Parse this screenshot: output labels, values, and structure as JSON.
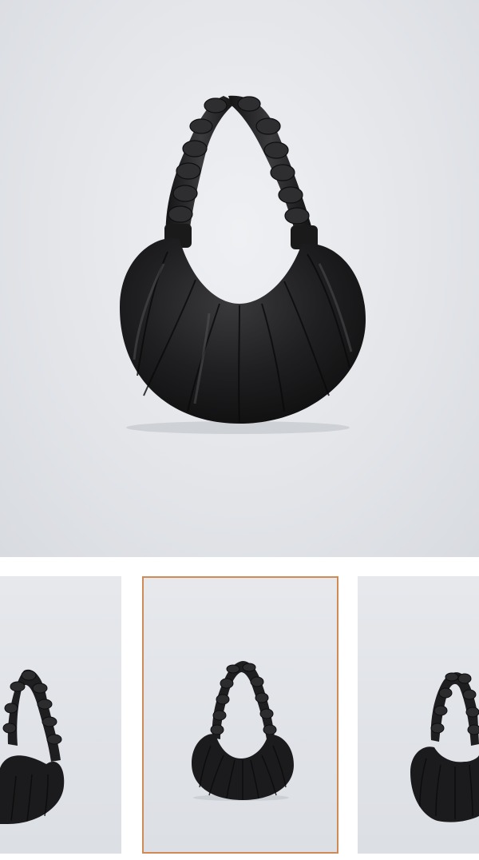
{
  "gallery": {
    "main_image": {
      "icon": "black-ruched-hobo-bag-photo"
    },
    "thumbnails": [
      {
        "icon": "bag-angle-left-photo",
        "selected": false
      },
      {
        "icon": "bag-front-photo",
        "selected": true
      },
      {
        "icon": "bag-angle-right-photo",
        "selected": false
      }
    ],
    "colors": {
      "selected_border": "#cf8a55",
      "bag": "#1b1b1d",
      "backdrop": "#e3e5e9"
    }
  }
}
